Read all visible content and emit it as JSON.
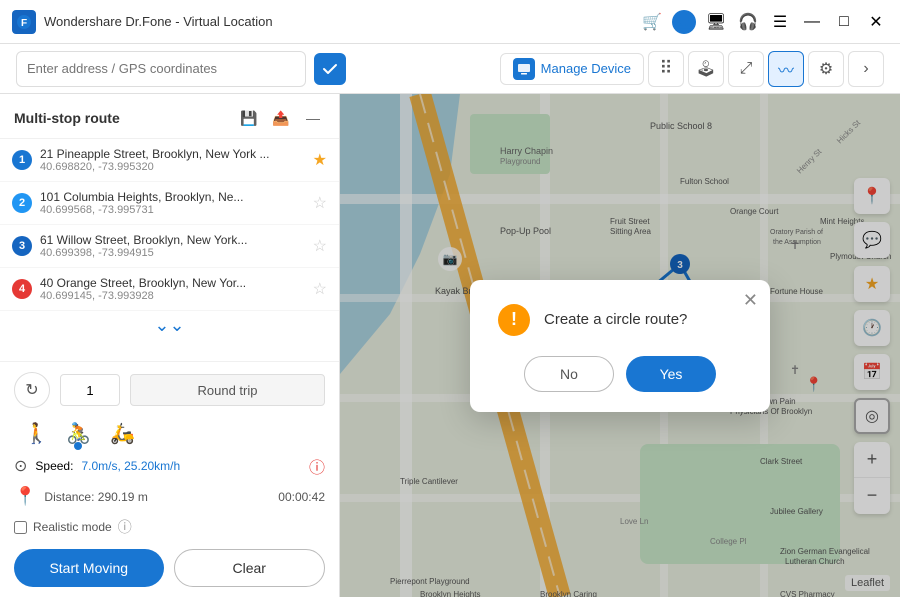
{
  "app": {
    "title": "Wondershare Dr.Fone - Virtual Location"
  },
  "toolbar": {
    "search_placeholder": "Enter address / GPS coordinates",
    "manage_device_label": "Manage Device"
  },
  "panel": {
    "title": "Multi-stop route",
    "routes": [
      {
        "num": "1",
        "addr": "21 Pineapple Street, Brooklyn, New York ...",
        "coords": "40.698820, -73.995320",
        "starred": true,
        "color": "blue"
      },
      {
        "num": "2",
        "addr": "101 Columbia Heights, Brooklyn, Ne...",
        "coords": "40.699568, -73.995731",
        "starred": false,
        "color": "n2"
      },
      {
        "num": "3",
        "addr": "61 Willow Street, Brooklyn, New York...",
        "coords": "40.699398, -73.994915",
        "starred": false,
        "color": "n3"
      },
      {
        "num": "4",
        "addr": "40 Orange Street, Brooklyn, New Yor...",
        "coords": "40.699145, -73.993928",
        "starred": false,
        "color": "n4"
      }
    ],
    "loop_count": "1",
    "round_trip_label": "Round trip",
    "speed_label": "Speed:",
    "speed_value": "7.0m/s, 25.20km/h",
    "distance_label": "Distance: 290.19 m",
    "duration_label": "00:00:42",
    "realistic_label": "Realistic mode",
    "start_btn": "Start Moving",
    "clear_btn": "Clear"
  },
  "dialog": {
    "title": "Create a circle route?",
    "no_label": "No",
    "yes_label": "Yes"
  },
  "map": {
    "leaflet": "Leaflet"
  }
}
